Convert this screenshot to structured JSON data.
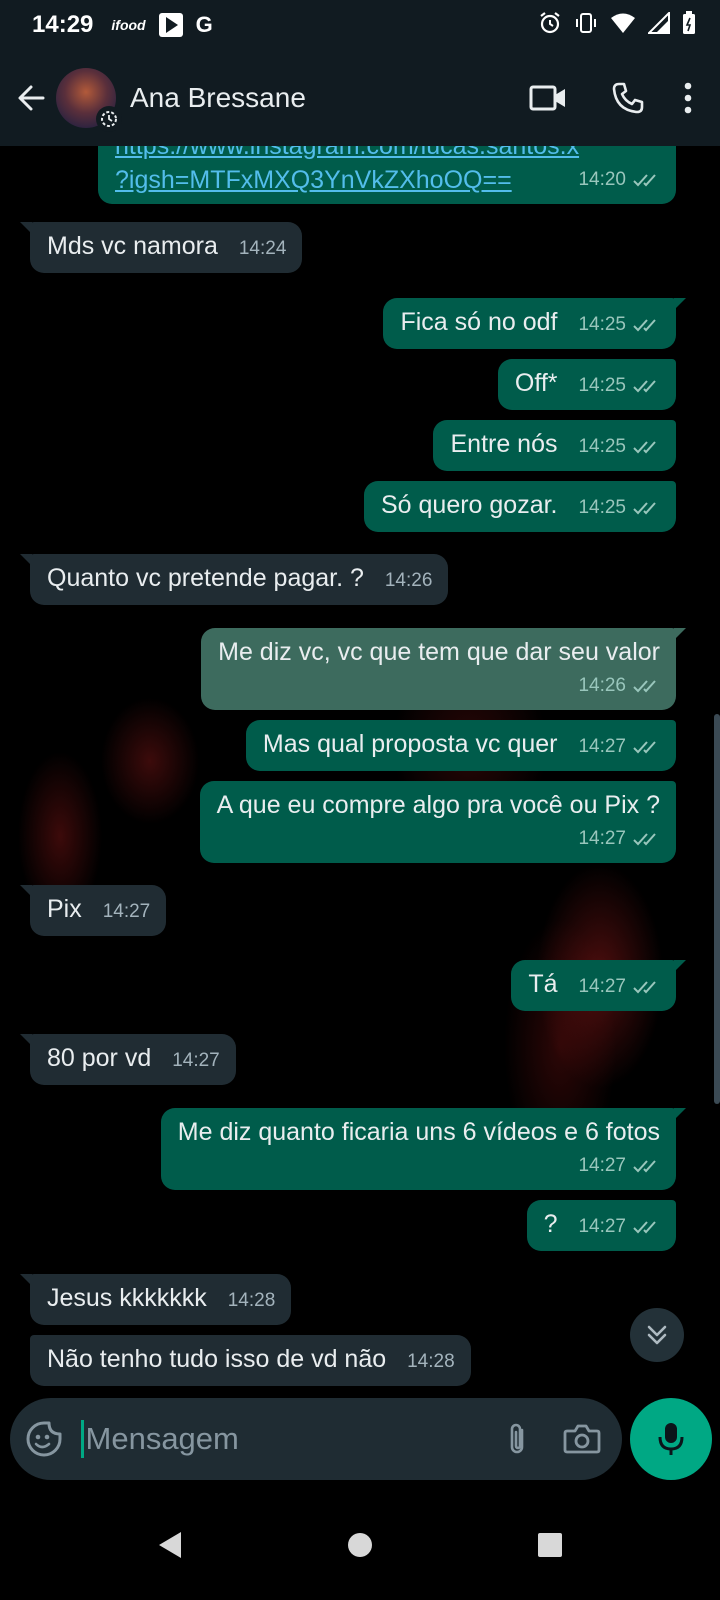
{
  "status_bar": {
    "time": "14:29",
    "left_icons": [
      "ifood-icon",
      "play-store-icon",
      "google-icon"
    ],
    "ifood_label": "ifood",
    "google_label": "G",
    "right_icons": [
      "alarm-icon",
      "vibrate-icon",
      "wifi-icon",
      "signal-icon",
      "battery-icon"
    ]
  },
  "header": {
    "contact_name": "Ana Bressane",
    "icons": [
      "back-arrow-icon",
      "video-call-icon",
      "phone-call-icon",
      "more-options-icon"
    ]
  },
  "messages": [
    {
      "dir": "out",
      "link_line1": "https://www.instagram.com/lucas.santos.x",
      "link_line2": "?igsh=MTFxMXQ3YnVkZXhoOQ==",
      "time": "14:20"
    },
    {
      "dir": "in",
      "text": "Mds vc namora",
      "time": "14:24"
    },
    {
      "dir": "out",
      "text": "Fica só no odf",
      "time": "14:25"
    },
    {
      "dir": "out",
      "text": "Off*",
      "time": "14:25"
    },
    {
      "dir": "out",
      "text": "Entre nós",
      "time": "14:25"
    },
    {
      "dir": "out",
      "text": "Só quero gozar.",
      "time": "14:25"
    },
    {
      "dir": "in",
      "text": "Quanto vc pretende pagar.  ?",
      "time": "14:26"
    },
    {
      "dir": "out",
      "text": "Me diz vc, vc que tem que dar seu valor",
      "time": "14:26"
    },
    {
      "dir": "out",
      "text": "Mas qual proposta vc quer",
      "time": "14:27"
    },
    {
      "dir": "out",
      "text": "A que eu compre algo pra você ou Pix ?",
      "time": "14:27"
    },
    {
      "dir": "in",
      "text": "Pix",
      "time": "14:27"
    },
    {
      "dir": "out",
      "text": "Tá",
      "time": "14:27"
    },
    {
      "dir": "in",
      "text": "80 por vd",
      "time": "14:27"
    },
    {
      "dir": "out",
      "text": "Me diz quanto ficaria uns 6 vídeos e 6 fotos",
      "time": "14:27"
    },
    {
      "dir": "out",
      "text": "?",
      "time": "14:27"
    },
    {
      "dir": "in",
      "text": "Jesus kkkkkkk",
      "time": "14:28"
    },
    {
      "dir": "in",
      "text": "Não tenho tudo isso de vd não",
      "time": "14:28"
    }
  ],
  "input": {
    "placeholder": "Mensagem",
    "icons": [
      "emoji-sticker-icon",
      "attach-icon",
      "camera-icon",
      "mic-icon"
    ]
  },
  "nav_bar": {
    "icons": [
      "back-triangle-icon",
      "home-circle-icon",
      "recents-square-icon"
    ]
  },
  "colors": {
    "header_bg": "#111b21",
    "incoming_bubble": "#202c33",
    "outgoing_bubble": "#005c4b",
    "accent_green": "#00a884",
    "link": "#53bdeb",
    "read_ticks": "#99c6bc"
  }
}
